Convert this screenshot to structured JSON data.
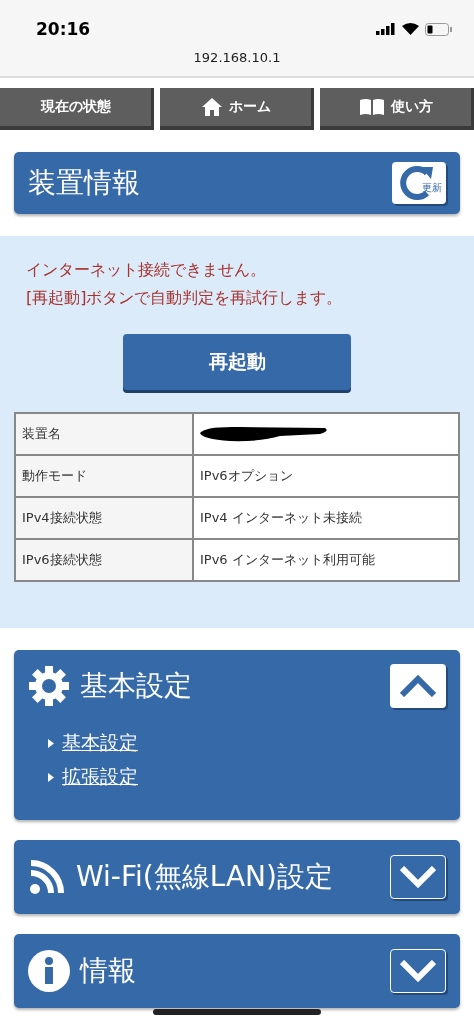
{
  "status_bar": {
    "time": "20:16"
  },
  "address_bar": {
    "url": "192.168.10.1"
  },
  "nav": [
    {
      "label": "現在の状態",
      "kind": "plain"
    },
    {
      "label": "ホーム",
      "kind": "home"
    },
    {
      "label": "使い方",
      "kind": "book"
    }
  ],
  "device_info": {
    "title": "装置情報",
    "refresh_label": "更新",
    "messages": [
      "インターネット接続できません。",
      "[再起動]ボタンで自動判定を再試行します。"
    ],
    "restart_button": "再起動",
    "rows": [
      {
        "label": "装置名",
        "redacted": true
      },
      {
        "label": "動作モード",
        "value": "IPv6オプション",
        "redacted": false
      },
      {
        "label": "IPv4接続状態",
        "value": "IPv4 インターネット未接続",
        "redacted": false
      },
      {
        "label": "IPv6接続状態",
        "value": "IPv6 インターネット利用可能",
        "redacted": false
      }
    ]
  },
  "sections": [
    {
      "title": "基本設定",
      "kind": "gear",
      "expanded": true,
      "links": [
        "基本設定",
        "拡張設定"
      ]
    },
    {
      "title": "Wi-Fi(無線LAN)設定",
      "kind": "wifi",
      "expanded": false
    },
    {
      "title": "情報",
      "kind": "info",
      "expanded": false
    }
  ]
}
